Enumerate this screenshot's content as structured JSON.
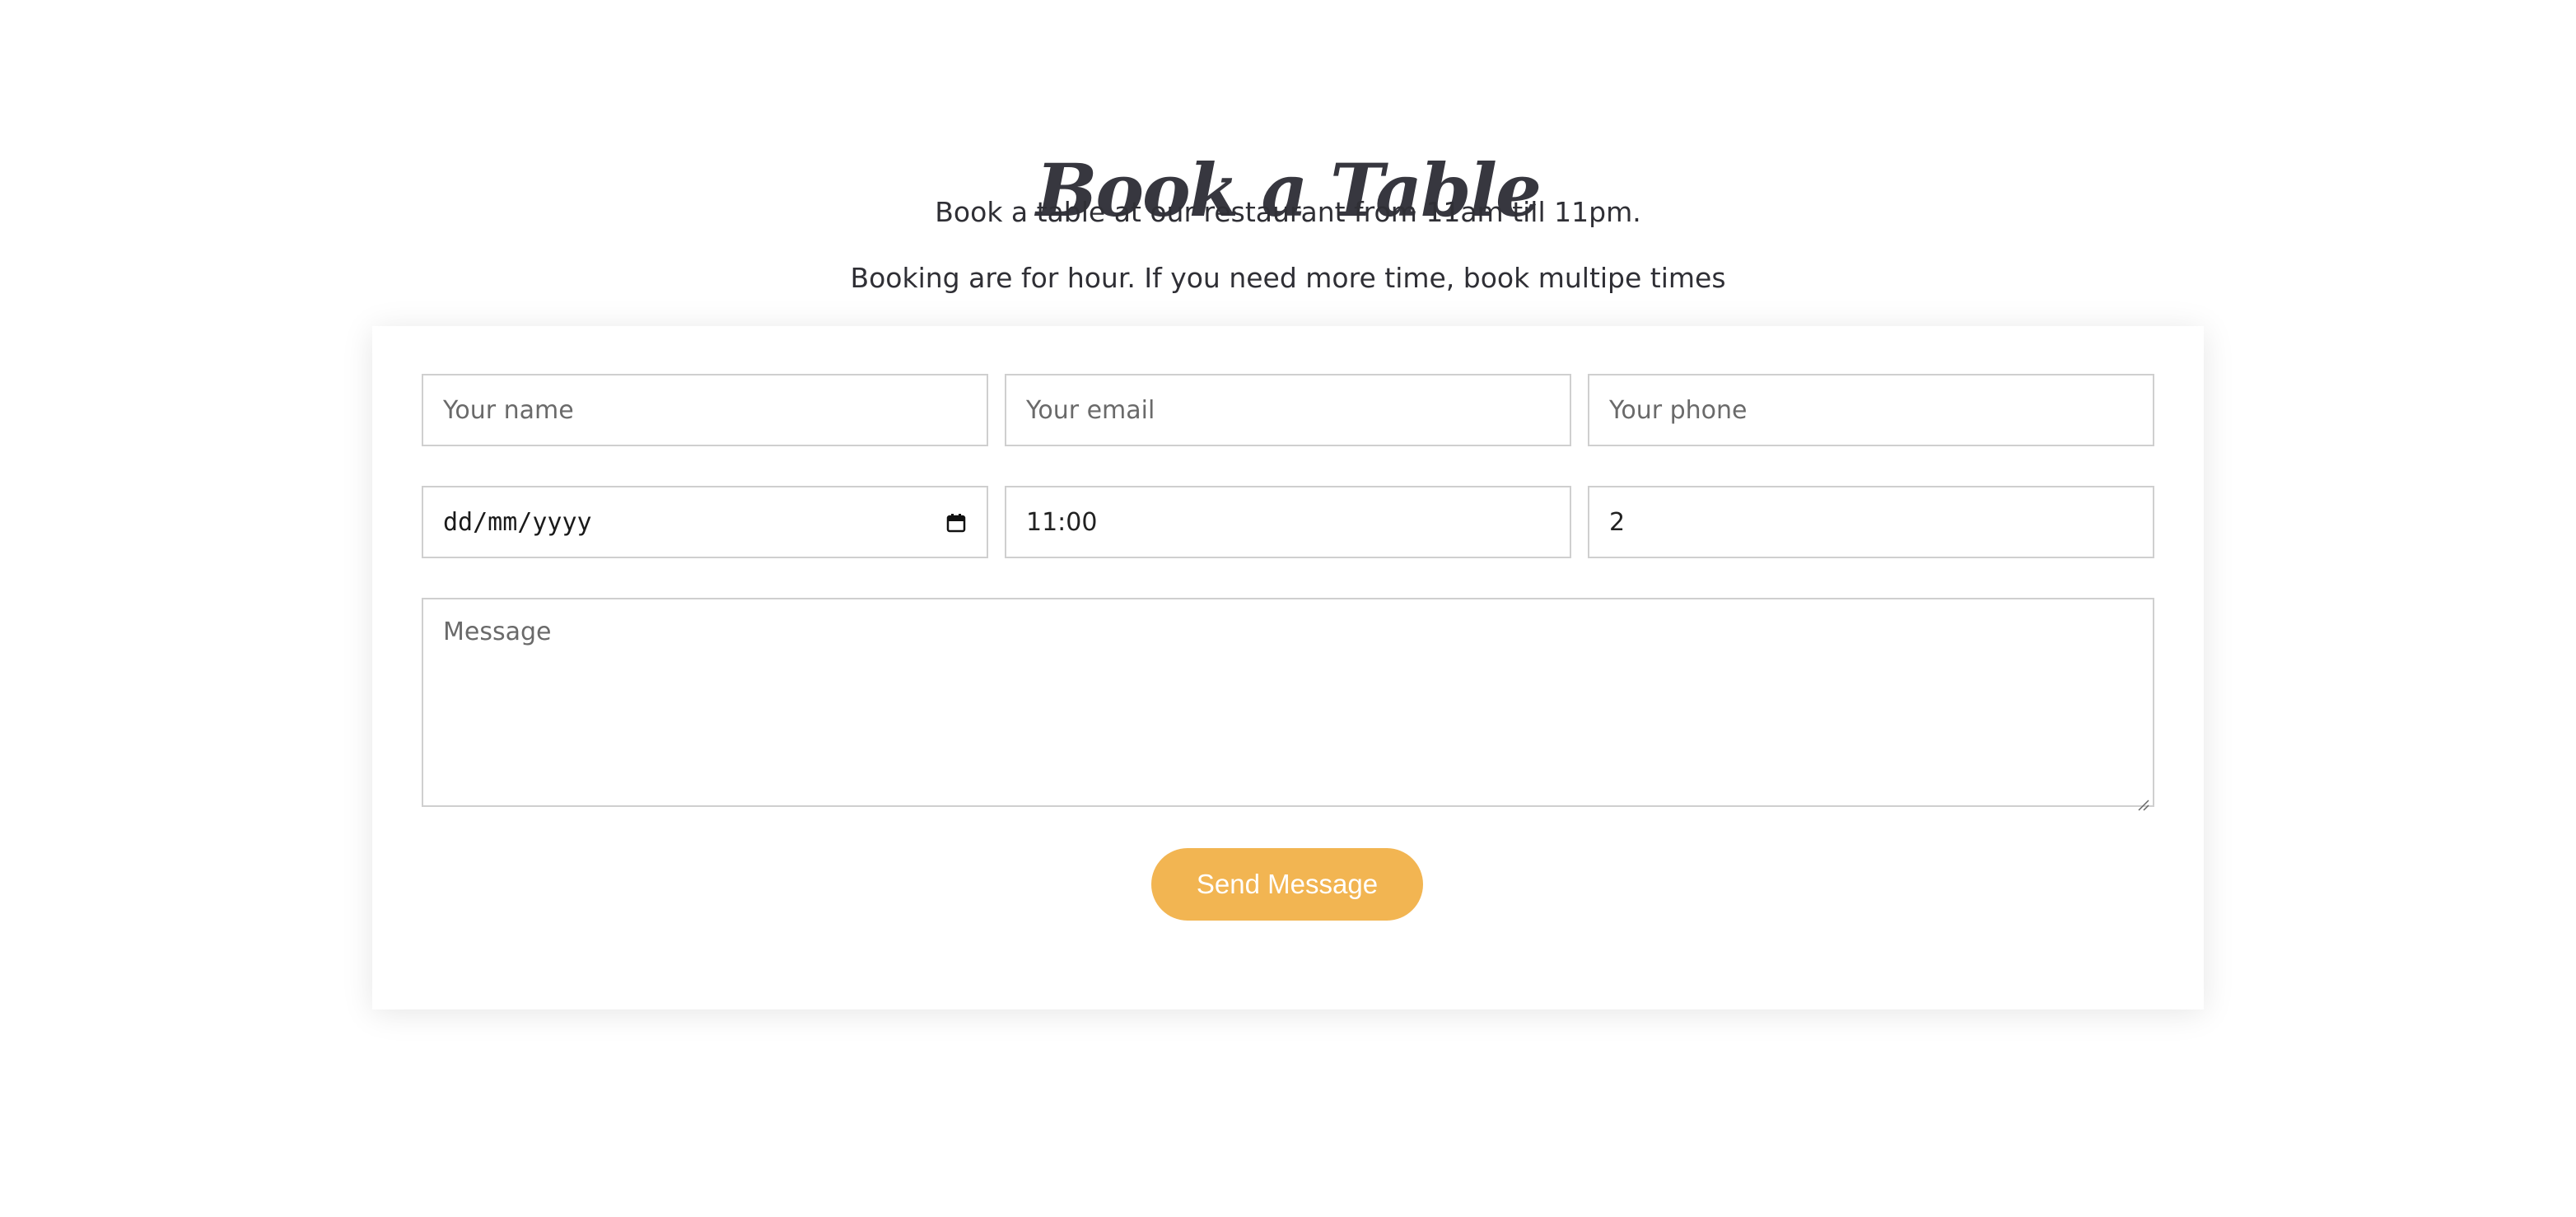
{
  "section": {
    "title": "Book a Table",
    "subtitle_line1": "Book a table at our restaurant from 11am till 11pm.",
    "subtitle_line2": "Booking are for hour. If you need more time, book multipe times"
  },
  "form": {
    "name_placeholder": "Your name",
    "email_placeholder": "Your email",
    "phone_placeholder": "Your phone",
    "date_value": "dd/mm/yyyy",
    "time_value": "11:00",
    "people_value": "2",
    "message_placeholder": "Message",
    "submit_label": "Send Message"
  },
  "colors": {
    "accent": "#f2b552",
    "text": "#37373f",
    "border": "#cfcfcf"
  },
  "icons": {
    "date": "calendar-icon",
    "textarea": "resize-grip-icon"
  }
}
